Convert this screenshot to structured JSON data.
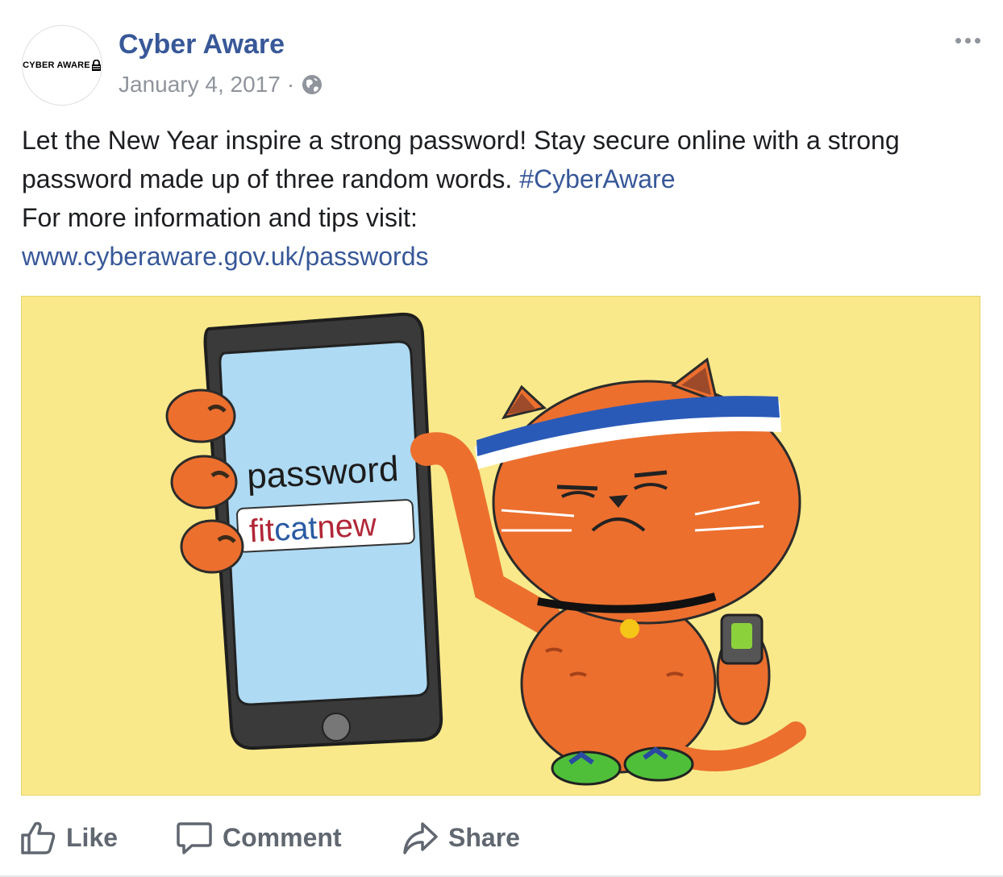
{
  "post": {
    "avatar": {
      "text": "CYBER AWARE",
      "icon": "lock-icon"
    },
    "page_name": "Cyber Aware",
    "date": "January 4, 2017",
    "separator": "·",
    "privacy_icon": "globe-icon",
    "more_icon": "ellipsis-icon",
    "text": {
      "line1": "Let the New Year inspire a strong password! Stay secure online with a strong password made up of three random words.",
      "hashtag": "#CyberAware",
      "line2": "For more information and tips visit:",
      "link": "www.cyberaware.gov.uk/passwords"
    },
    "image": {
      "description_texts": {
        "label": "password",
        "word1": "fit",
        "word2": "cat",
        "word3": "new"
      },
      "colors": {
        "background": "#f9e98a",
        "cat": "#ec6f2e",
        "screen": "#aedaf3"
      }
    },
    "actions": [
      {
        "label": "Like",
        "icon": "thumbs-up-icon"
      },
      {
        "label": "Comment",
        "icon": "comment-icon"
      },
      {
        "label": "Share",
        "icon": "share-icon"
      }
    ]
  }
}
